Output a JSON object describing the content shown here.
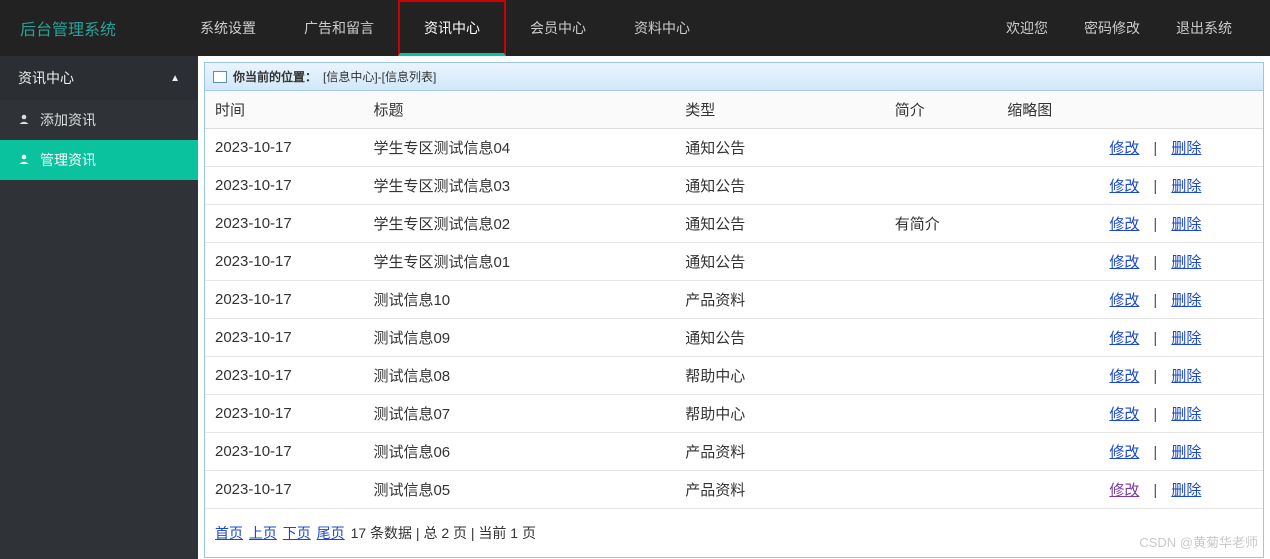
{
  "header": {
    "logo": "后台管理系统",
    "nav": [
      {
        "label": "系统设置"
      },
      {
        "label": "广告和留言"
      },
      {
        "label": "资讯中心",
        "active": true
      },
      {
        "label": "会员中心"
      },
      {
        "label": "资料中心"
      }
    ],
    "right": [
      {
        "label": "欢迎您"
      },
      {
        "label": "密码修改"
      },
      {
        "label": "退出系统"
      }
    ]
  },
  "sidebar": {
    "title": "资讯中心",
    "items": [
      {
        "label": "添加资讯"
      },
      {
        "label": "管理资讯",
        "active": true
      }
    ]
  },
  "breadcrumb": {
    "prefix": "你当前的位置：",
    "path": "[信息中心]-[信息列表]"
  },
  "table": {
    "columns": {
      "time": "时间",
      "title": "标题",
      "type": "类型",
      "intro": "简介",
      "thumb": "缩略图",
      "actions": ""
    },
    "rows": [
      {
        "time": "2023-10-17",
        "title": "学生专区测试信息04",
        "type": "通知公告",
        "intro": "",
        "thumb": ""
      },
      {
        "time": "2023-10-17",
        "title": "学生专区测试信息03",
        "type": "通知公告",
        "intro": "",
        "thumb": ""
      },
      {
        "time": "2023-10-17",
        "title": "学生专区测试信息02",
        "type": "通知公告",
        "intro": "有简介",
        "thumb": ""
      },
      {
        "time": "2023-10-17",
        "title": "学生专区测试信息01",
        "type": "通知公告",
        "intro": "",
        "thumb": ""
      },
      {
        "time": "2023-10-17",
        "title": "测试信息10",
        "type": "产品资料",
        "intro": "",
        "thumb": ""
      },
      {
        "time": "2023-10-17",
        "title": "测试信息09",
        "type": "通知公告",
        "intro": "",
        "thumb": ""
      },
      {
        "time": "2023-10-17",
        "title": "测试信息08",
        "type": "帮助中心",
        "intro": "",
        "thumb": ""
      },
      {
        "time": "2023-10-17",
        "title": "测试信息07",
        "type": "帮助中心",
        "intro": "",
        "thumb": ""
      },
      {
        "time": "2023-10-17",
        "title": "测试信息06",
        "type": "产品资料",
        "intro": "",
        "thumb": ""
      },
      {
        "time": "2023-10-17",
        "title": "测试信息05",
        "type": "产品资料",
        "intro": "",
        "thumb": "",
        "visited": true
      }
    ],
    "action_labels": {
      "edit": "修改",
      "delete": "删除",
      "sep": "|"
    }
  },
  "pager": {
    "first": "首页",
    "prev": "上页",
    "next": "下页",
    "last": "尾页",
    "summary": " 17 条数据 | 总 2 页 | 当前 1 页"
  },
  "watermark": "CSDN @黄菊华老师"
}
